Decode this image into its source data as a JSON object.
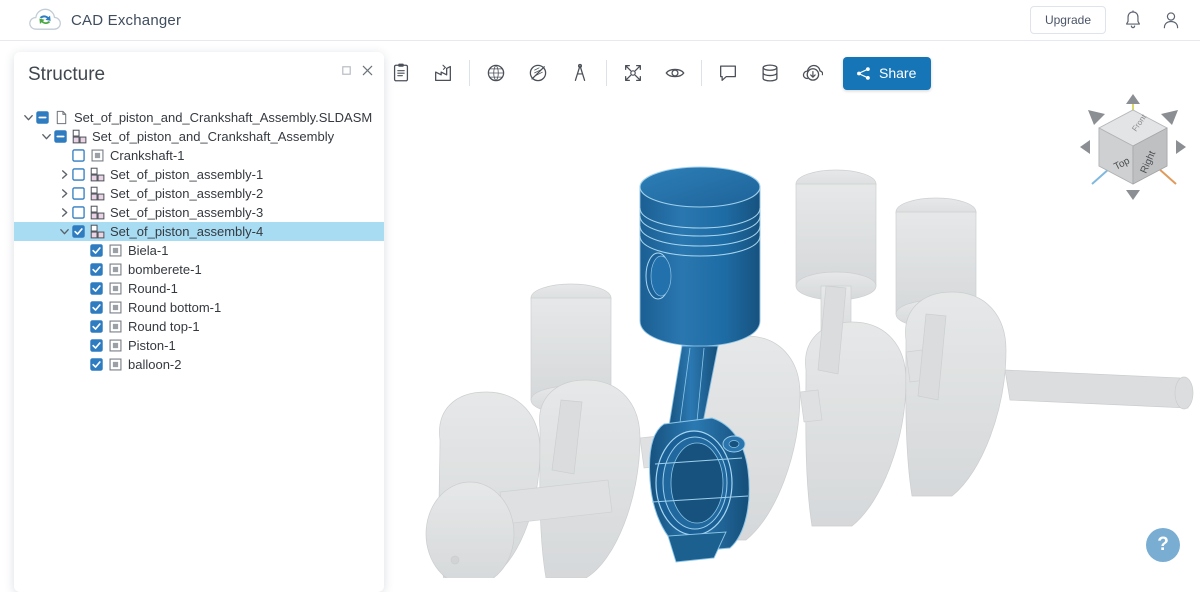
{
  "app": {
    "brand_name": "CAD Exchanger",
    "logo_icon": "cloud-exchange-logo",
    "accent_color": "#1675b6",
    "selection_color": "#a8dcf2",
    "model_color": "#1e6ca5"
  },
  "header": {
    "upgrade_label": "Upgrade",
    "notifications_icon": "bell-icon",
    "account_icon": "user-icon"
  },
  "toolbar": {
    "buttons": [
      {
        "name": "properties-icon",
        "title": "Properties"
      },
      {
        "name": "bom-chart-icon",
        "title": "Bill of materials"
      },
      {
        "name": "mesh-globe-icon",
        "title": "Tessellation"
      },
      {
        "name": "section-plane-icon",
        "title": "Clip plane"
      },
      {
        "name": "measure-icon",
        "title": "Measure"
      },
      {
        "name": "explode-icon",
        "title": "Explode"
      },
      {
        "name": "visibility-eye-icon",
        "title": "Visibility"
      },
      {
        "name": "note-icon",
        "title": "Notes"
      },
      {
        "name": "database-icon",
        "title": "Versions"
      },
      {
        "name": "cloud-download-icon",
        "title": "Download"
      }
    ],
    "share_label": "Share",
    "share_icon": "share-nodes-icon"
  },
  "structure_panel": {
    "title": "Structure",
    "maximize_icon": "restore-icon",
    "close_icon": "close-icon",
    "tree": [
      {
        "label": "Set_of_piston_and_Crankshaft_Assembly.SLDASM",
        "depth": 0,
        "twisty": "down",
        "check": "indeterminate",
        "icon": "file-icon",
        "selected": false
      },
      {
        "label": "Set_of_piston_and_Crankshaft_Assembly",
        "depth": 1,
        "twisty": "down",
        "check": "indeterminate",
        "icon": "assembly-icon",
        "selected": false
      },
      {
        "label": "Crankshaft-1",
        "depth": 2,
        "twisty": "none",
        "check": "unchecked",
        "icon": "part-icon",
        "selected": false
      },
      {
        "label": "Set_of_piston_assembly-1",
        "depth": 2,
        "twisty": "right",
        "check": "unchecked",
        "icon": "assembly-icon",
        "selected": false
      },
      {
        "label": "Set_of_piston_assembly-2",
        "depth": 2,
        "twisty": "right",
        "check": "unchecked",
        "icon": "assembly-icon",
        "selected": false
      },
      {
        "label": "Set_of_piston_assembly-3",
        "depth": 2,
        "twisty": "right",
        "check": "unchecked",
        "icon": "assembly-icon",
        "selected": false
      },
      {
        "label": "Set_of_piston_assembly-4",
        "depth": 2,
        "twisty": "down",
        "check": "checked",
        "icon": "assembly-icon",
        "selected": true
      },
      {
        "label": "Biela-1",
        "depth": 3,
        "twisty": "none",
        "check": "checked",
        "icon": "part-icon",
        "selected": false
      },
      {
        "label": "bomberete-1",
        "depth": 3,
        "twisty": "none",
        "check": "checked",
        "icon": "part-icon",
        "selected": false
      },
      {
        "label": "Round-1",
        "depth": 3,
        "twisty": "none",
        "check": "checked",
        "icon": "part-icon",
        "selected": false
      },
      {
        "label": "Round bottom-1",
        "depth": 3,
        "twisty": "none",
        "check": "checked",
        "icon": "part-icon",
        "selected": false
      },
      {
        "label": "Round top-1",
        "depth": 3,
        "twisty": "none",
        "check": "checked",
        "icon": "part-icon",
        "selected": false
      },
      {
        "label": "Piston-1",
        "depth": 3,
        "twisty": "none",
        "check": "checked",
        "icon": "part-icon",
        "selected": false
      },
      {
        "label": "balloon-2",
        "depth": 3,
        "twisty": "none",
        "check": "checked",
        "icon": "part-icon",
        "selected": false
      }
    ]
  },
  "navcube": {
    "face_top_label": "Top",
    "face_right_label": "Right",
    "face_front_label": "Front",
    "arrows": [
      "up",
      "down",
      "left",
      "right",
      "up-left",
      "up-right",
      "down-left",
      "down-right"
    ]
  },
  "help": {
    "label": "?"
  },
  "viewport": {
    "model_name": "Set_of_piston_and_Crankshaft_Assembly",
    "highlighted_component": "Set_of_piston_assembly-4",
    "ghost_color": "#d2d4d6",
    "background": "#ffffff"
  }
}
